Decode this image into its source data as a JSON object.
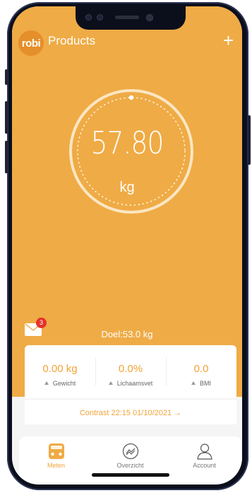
{
  "header": {
    "logo_text": "robi",
    "title": "Products",
    "add_icon": "plus-icon"
  },
  "measurement": {
    "weight": "57.80",
    "unit": "kg",
    "goal": "Doel:53.0 kg"
  },
  "messages": {
    "badge_count": "3",
    "icon": "envelope-icon"
  },
  "stats": [
    {
      "value": "0.00 kg",
      "label": "Gewicht"
    },
    {
      "value": "0.0%",
      "label": "Lichaamsvet"
    },
    {
      "value": "0.0",
      "label": "BMI"
    }
  ],
  "contrast": {
    "label": "Contrast 22:15 01/10/2021 →"
  },
  "tabs": [
    {
      "label": "Meten",
      "icon": "scale-icon",
      "active": true
    },
    {
      "label": "Overzicht",
      "icon": "chart-icon",
      "active": false
    },
    {
      "label": "Account",
      "icon": "user-icon",
      "active": false
    }
  ],
  "colors": {
    "accent": "#efab45",
    "accent_text": "#f0a437",
    "badge": "#e5332a"
  }
}
